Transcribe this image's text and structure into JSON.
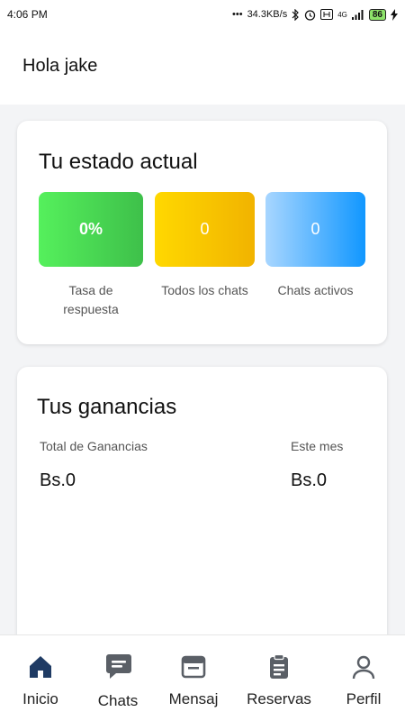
{
  "status_bar": {
    "time": "4:06 PM",
    "network_speed": "34.3KB/s",
    "network_type": "4G",
    "battery": "86",
    "icons": [
      "dots-icon",
      "bluetooth-icon",
      "alarm-icon",
      "volte-icon",
      "signal-icon",
      "battery-icon",
      "charging-icon"
    ]
  },
  "header": {
    "greeting": "Hola jake"
  },
  "status_card": {
    "title": "Tu estado actual",
    "stats": [
      {
        "value": "0%",
        "label": "Tasa de respuesta",
        "color": "#4cd94f"
      },
      {
        "value": "0",
        "label": "Todos los chats",
        "color": "#f5c300"
      },
      {
        "value": "0",
        "label": "Chats activos",
        "color": "#2aa3ff"
      }
    ]
  },
  "earnings_card": {
    "title": "Tus ganancias",
    "total_label": "Total de Ganancias",
    "total_value": "Bs.0",
    "month_label": "Este mes",
    "month_value": "Bs.0"
  },
  "bottom_nav": {
    "items": [
      {
        "label": "Inicio",
        "icon": "home-icon",
        "active": true
      },
      {
        "label": "Chats",
        "icon": "chat-icon",
        "active": false
      },
      {
        "label": "Mensaj",
        "icon": "message-window-icon",
        "active": false
      },
      {
        "label": "Reservas",
        "icon": "clipboard-icon",
        "active": false
      },
      {
        "label": "Perfil",
        "icon": "user-icon",
        "active": false
      }
    ],
    "active_color": "#1f3b64",
    "inactive_color": "#5a5f66"
  }
}
